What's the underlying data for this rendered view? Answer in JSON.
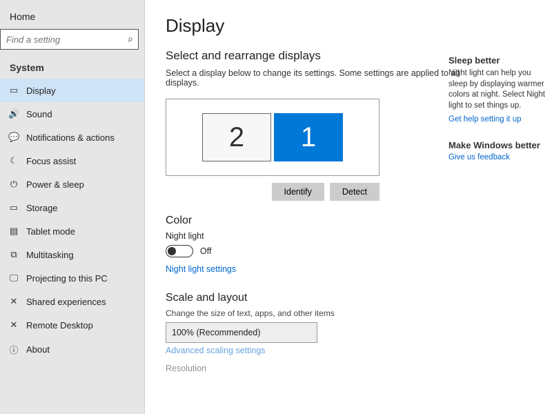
{
  "sidebar": {
    "home": "Home",
    "search_placeholder": "Find a setting",
    "section": "System",
    "items": [
      {
        "icon": "▭",
        "label": "Display"
      },
      {
        "icon": "🔊",
        "label": "Sound"
      },
      {
        "icon": "💬",
        "label": "Notifications & actions"
      },
      {
        "icon": "☾",
        "label": "Focus assist"
      },
      {
        "icon": "⏻",
        "label": "Power & sleep"
      },
      {
        "icon": "▭",
        "label": "Storage"
      },
      {
        "icon": "▤",
        "label": "Tablet mode"
      },
      {
        "icon": "⧉",
        "label": "Multitasking"
      },
      {
        "icon": "🖵",
        "label": "Projecting to this PC"
      },
      {
        "icon": "✕",
        "label": "Shared experiences"
      },
      {
        "icon": "✕",
        "label": "Remote Desktop"
      },
      {
        "icon": "ⓘ",
        "label": "About"
      }
    ]
  },
  "main": {
    "title": "Display",
    "arrange_heading": "Select and rearrange displays",
    "arrange_desc": "Select a display below to change its settings. Some settings are applied to all displays.",
    "displays": [
      {
        "id": "2",
        "selected": false
      },
      {
        "id": "1",
        "selected": true
      }
    ],
    "identify_btn": "Identify",
    "detect_btn": "Detect",
    "color_heading": "Color",
    "night_light_label": "Night light",
    "night_light_state": "Off",
    "night_light_link": "Night light settings",
    "scale_heading": "Scale and layout",
    "scale_desc": "Change the size of text, apps, and other items",
    "scale_value": "100% (Recommended)",
    "advanced_scaling": "Advanced scaling settings",
    "resolution_label": "Resolution"
  },
  "right": {
    "sleep_title": "Sleep better",
    "sleep_body": "Night light can help you sleep by displaying warmer colors at night. Select Night light to set things up.",
    "sleep_link": "Get help setting it up",
    "feedback_title": "Make Windows better",
    "feedback_link": "Give us feedback"
  }
}
